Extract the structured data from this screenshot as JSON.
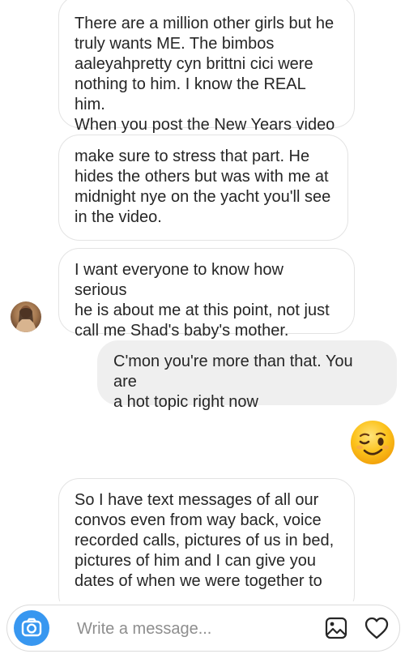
{
  "messages": [
    {
      "direction": "incoming",
      "text": "There are a million other girls but he\ntruly wants ME. The bimbos\naaleyahpretty cyn brittni cici were\nnothing to him. I know the REAL him.\nWhen you post the New Years video"
    },
    {
      "direction": "incoming",
      "text": "make sure to stress that part. He\nhides the others but was with me at\nmidnight nye on the yacht you'll see\nin the video."
    },
    {
      "direction": "incoming",
      "text": "I want everyone to know how serious\nhe is about me at this point, not just\ncall me Shad's baby's mother."
    },
    {
      "direction": "outgoing",
      "text": "C'mon you're more than that. You are\na hot topic right now"
    },
    {
      "direction": "outgoing",
      "emoji": "winking-face"
    },
    {
      "direction": "incoming",
      "text": "So I have text messages of all our\nconvos even from way back, voice\nrecorded calls, pictures of us in bed,\npictures of him and I can give you\ndates of when we were together to"
    }
  ],
  "composer": {
    "placeholder": "Write a message...",
    "camera_icon": "camera-icon",
    "gallery_icon": "image-icon",
    "like_icon": "heart-icon"
  },
  "colors": {
    "accent": "#3897f0",
    "outgoing_bubble": "#efefef",
    "incoming_border": "#e3e3e3",
    "text": "#262626",
    "placeholder": "#8e8e8e"
  }
}
